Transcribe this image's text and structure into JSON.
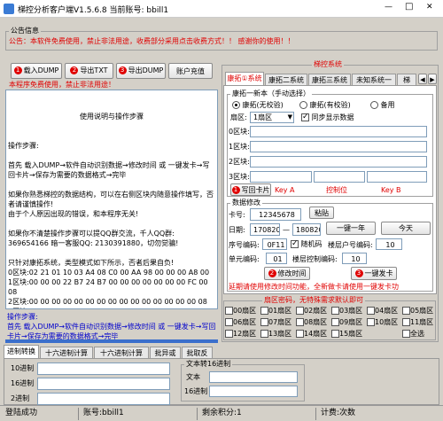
{
  "title": "梯控分析客户端V1.5.6.8  当前账号: bbill1",
  "window_controls": {
    "min": "—",
    "max": "□",
    "close": "✕"
  },
  "notice": {
    "heading": "公告信息",
    "text": "公告：本软件免费使用，禁止非法用途，收费部分采用点击收费方式！！       感谢你的使用！！"
  },
  "left_buttons": {
    "load_dump": "载入DUMP",
    "export_txt": "导出TXT",
    "export_dump": "导出DUMP",
    "account_recharge": "账户充值",
    "load_num": "1",
    "export_txt_num": "2",
    "export_dump_num": "3"
  },
  "warning": "本程序免费使用，禁止非法用途！",
  "main_text": {
    "title": "使用说明与操作步骤",
    "body": "操作步骤:\n\n首先 载入DUMP→软件自动识别数据→修改时间 或 一键发卡→写回卡片→保存为需要的数据格式→完毕\n\n如果你熟悉梯控的数据结构，可以在右侧区块内随意操作填写，否者请谨慎操作!\n由于个人原因出现的错误，和本程序无关!\n\n如果你不清楚操作步骤可以提QQ群交流，千人QQ群: 369654166 暗一客服QQ: 2130391880，切勿觉骗!\n\n只针对康拓系统，类型模式如下所示，否者后果自负!\n0区块:02 21 01 10 03 A4 08 C0 00 AA 98 00 00 00 A8 00\n1区块:00 00 00 22 B7 24 B7 00 00 00 00 00 00 00 FC 00 08\n2区块:00 00 00 00 00 00 00 00 00 00 00 00 00 00 00 08\n3区块:B2 87 42 78 23 BE FF 07 80 69 B2 87 42 78 23 BE"
  },
  "footer_steps": {
    "label": "操作步骤:",
    "text": "首先 载入DUMP→软件自动识别数据→修改时间 或 一键发卡→写回卡片→保存为需要的数据格式→完毕"
  },
  "bottom_tabs": [
    "进制转换",
    "十六进制计算",
    "十六进制计算",
    "批异或",
    "批取反"
  ],
  "converter": {
    "dec_label": "10进制",
    "hex_label": "16进制",
    "bin_label": "2进制",
    "text_to_hex_title": "文本转16进制",
    "text_label": "文本",
    "hex2_label": "16进制"
  },
  "status_bar": {
    "login": "登陆成功",
    "account": "账号:bbill1",
    "points": "剩余积分:1",
    "billing": "计费:次数"
  },
  "right_panel": {
    "title": "梯控系统",
    "tabs": [
      "康拓①系统",
      "康拓二系统",
      "康拓三系统",
      "未知系统一",
      "梯"
    ],
    "group1_title": "康拓一新本（手动选择）",
    "radio_options": [
      "康拓(无校验)",
      "康拓(有校验)",
      "备用"
    ],
    "sector_label": "扇区:",
    "sector_value": "1扇区",
    "sync_label": "同步显示数据",
    "block_labels": [
      "0区块:",
      "1区块:",
      "2区块:",
      "3区块:"
    ],
    "write_card": "写回卡片",
    "write_num": "1",
    "key_a_label": "Key A",
    "control_label": "控制位",
    "key_b_label": "Key B",
    "group2_title": "数据修改",
    "card_no_label": "卡号:",
    "card_no_value": "12345678",
    "paste_btn": "粘贴",
    "date_label": "日期:",
    "date_start": "170820",
    "date_sep": "—",
    "date_end": "180820",
    "one_year_btn": "一键一年",
    "today_btn": "今天",
    "seq_label": "序号编码:",
    "seq_value": "0F11",
    "random_label": "随机码",
    "floor_user_label": "楼层户号编码:",
    "floor_user_value": "10",
    "unit_label": "单元编码:",
    "unit_value": "01",
    "floor_ctrl_label": "楼层控制编码:",
    "floor_ctrl_value": "10",
    "modify_time_btn": "修改时间",
    "modify_num": "2",
    "issue_card_btn": "一键发卡",
    "issue_num": "3",
    "extend_note": "延期请使用修改时间功能，全新做卡请使用一键发卡功",
    "sector_pw_title": "扇区密码，无特殊需求默认即可",
    "sectors": [
      "00扇区",
      "01扇区",
      "02扇区",
      "03扇区",
      "04扇区",
      "05扇区",
      "06扇区",
      "07扇区",
      "08扇区",
      "09扇区",
      "10扇区",
      "11扇区",
      "12扇区",
      "13扇区",
      "14扇区",
      "15扇区"
    ],
    "select_all": "全选"
  },
  "colors": {
    "accent_red": "#e00000",
    "link_blue": "#0000cc",
    "window_bg": "#d4d0c8"
  }
}
